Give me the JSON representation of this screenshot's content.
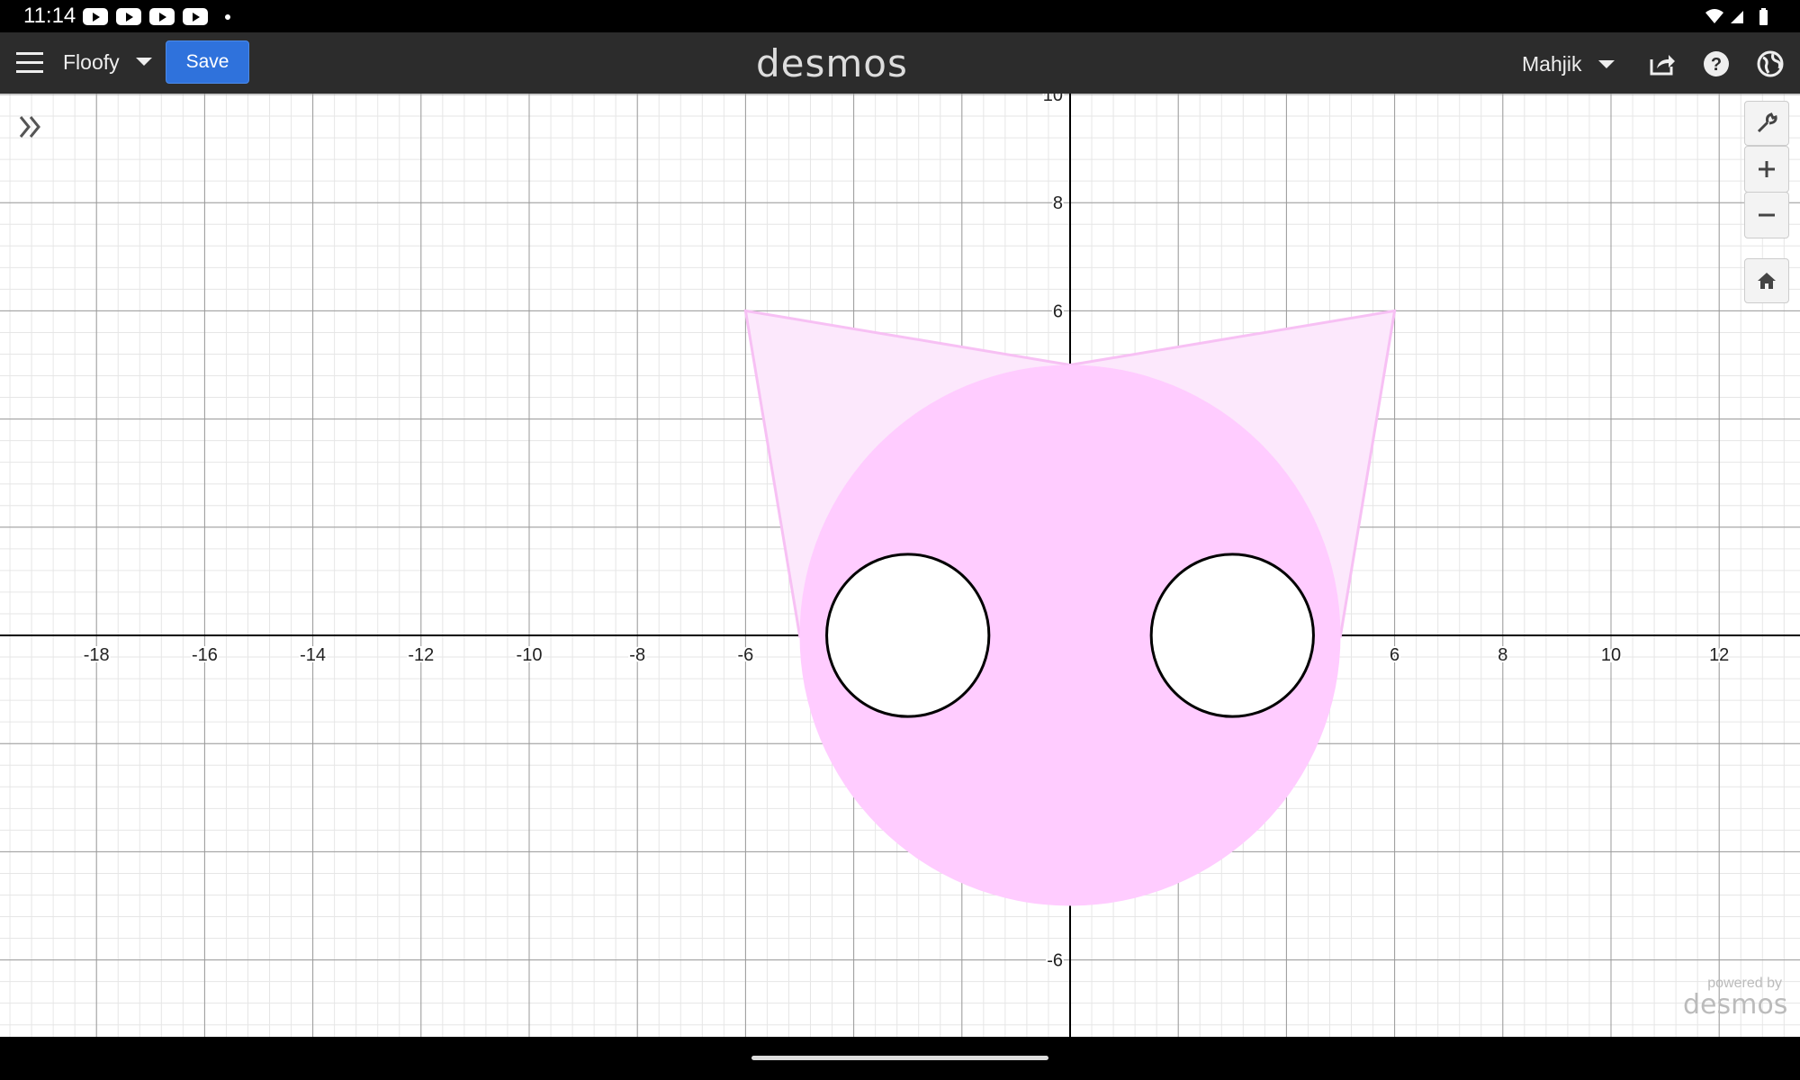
{
  "status_bar": {
    "time": "11:14"
  },
  "header": {
    "graph_title": "Floofy",
    "save_label": "Save",
    "brand": "desmos",
    "user_name": "Mahjik"
  },
  "graph": {
    "x_tick_labels": [
      "-18",
      "-16",
      "-14",
      "-12",
      "-10",
      "-8",
      "-6",
      "6",
      "8",
      "10",
      "12"
    ],
    "y_tick_labels": [
      "10",
      "8",
      "6",
      "-6"
    ],
    "shapes": {
      "head_circle": {
        "center": [
          0,
          0
        ],
        "radius": 5
      },
      "left_eye": {
        "center": [
          -3,
          0
        ],
        "radius": 1.5
      },
      "right_eye": {
        "center": [
          3,
          0
        ],
        "radius": 1.5
      },
      "left_ear": [
        [
          -6,
          6
        ],
        [
          0,
          5
        ],
        [
          -5,
          0
        ]
      ],
      "right_ear": [
        [
          6,
          6
        ],
        [
          0,
          5
        ],
        [
          5,
          0
        ]
      ]
    },
    "colors": {
      "fill": "#ffccff",
      "ear_fill": "#fce8fc",
      "ear_stroke": "#f7c0f4",
      "eye_stroke": "#000000"
    }
  },
  "watermark": {
    "powered_by": "powered by",
    "brand": "desmos"
  }
}
